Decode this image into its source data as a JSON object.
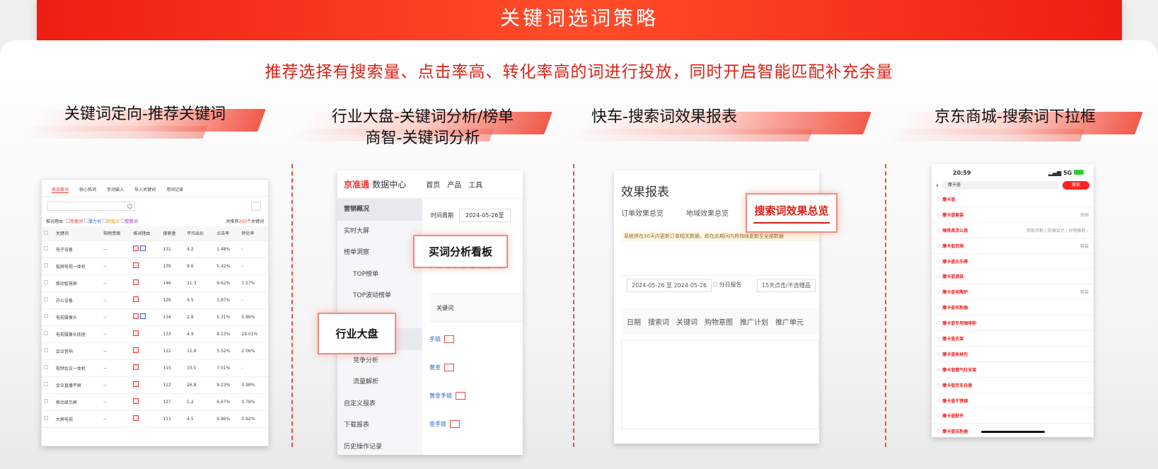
{
  "banner_title": "关键词选词策略",
  "subtitle": "推荐选择有搜索量、点击率高、转化率高的词进行投放，同时开启智能匹配补充余量",
  "sections": [
    {
      "label": "关键词定向-推荐关键词"
    },
    {
      "label": "行业大盘-关键词分析/榜单",
      "label2": "商智-关键词分析"
    },
    {
      "label": "快车-搜索词效果报表"
    },
    {
      "label": "京东商城-搜索词下拉框"
    }
  ],
  "s1": {
    "tabs": [
      "商品推词",
      "核心拓词",
      "手动输入",
      "导入关键词",
      "用词记录"
    ],
    "reason_label": "推词理由:",
    "reasons": [
      "热搜词",
      "潜力词",
      "拍搜词",
      "整套词"
    ],
    "total_prefix": "共推荐",
    "total_count": "203",
    "total_suffix": "个关键词",
    "headers": [
      "关键词",
      "购物意图",
      "推词理由",
      "搜索量",
      "平均出价",
      "点击率",
      "转化率"
    ],
    "rows": [
      {
        "kw": "电子设备",
        "intent": "--",
        "two": true,
        "vol": "131",
        "bid": "4.2",
        "ctr": "1.48%",
        "cvr": "-"
      },
      {
        "kw": "投屏电视一体机",
        "intent": "--",
        "two": false,
        "vol": "139",
        "bid": "9.6",
        "ctr": "5.42%",
        "cvr": "-"
      },
      {
        "kw": "移动智慧屏",
        "intent": "--",
        "two": false,
        "vol": "146",
        "bid": "11.3",
        "ctr": "9.62%",
        "cvr": "1.57%"
      },
      {
        "kw": "办公设备",
        "intent": "--",
        "two": false,
        "vol": "126",
        "bid": "9.5",
        "ctr": "1.87%",
        "cvr": "-"
      },
      {
        "kw": "电视摄像头",
        "intent": "--",
        "two": true,
        "vol": "134",
        "bid": "2.8",
        "ctr": "5.31%",
        "cvr": "5.86%"
      },
      {
        "kw": "电视摄像头底座",
        "intent": "--",
        "two": false,
        "vol": "133",
        "bid": "4.9",
        "ctr": "8.13%",
        "cvr": "29.01%"
      },
      {
        "kw": "会议音响",
        "intent": "--",
        "two": false,
        "vol": "122",
        "bid": "12.8",
        "ctr": "5.52%",
        "cvr": "2.06%"
      },
      {
        "kw": "视频会议一体机",
        "intent": "--",
        "two": false,
        "vol": "115",
        "bid": "33.5",
        "ctr": "7.01%",
        "cvr": "-"
      },
      {
        "kw": "会议直播平屏",
        "intent": "--",
        "two": false,
        "vol": "122",
        "bid": "26.8",
        "ctr": "9.23%",
        "cvr": "0.98%"
      },
      {
        "kw": "移动显示屏",
        "intent": "--",
        "two": false,
        "vol": "127",
        "bid": "5.2",
        "ctr": "6.67%",
        "cvr": "0.78%"
      },
      {
        "kw": "大屏电视",
        "intent": "--",
        "two": false,
        "vol": "113",
        "bid": "4.5",
        "ctr": "9.86%",
        "cvr": "0.92%"
      }
    ]
  },
  "s2": {
    "logo": "京准通",
    "logo_sub": "数据中心",
    "nav": [
      "首页",
      "产品",
      "工具"
    ],
    "side": [
      "营销概况",
      "实时大屏",
      "榜单洞察",
      "TOP榜单",
      "TOP波动榜单",
      "",
      "竞争分析",
      "流量解析",
      "自定义报表",
      "下载报表",
      "历史操作记录"
    ],
    "date_label": "时间周期",
    "date_value": "2024-05-26至",
    "notice": "声明：已购关键词是根据您所属类",
    "col_header": "关键词",
    "keywords": [
      "手链",
      "黄金",
      "黄金手链",
      "金手链"
    ],
    "highlight1": "买词分析看板",
    "highlight2": "行业大盘"
  },
  "s3": {
    "title": "效果报表",
    "tabs": [
      "订单效果总览",
      "地域效果总览"
    ],
    "highlight": "搜索词效果总览",
    "notice": "系统将在30天内更新订单相关数据，即在此期间内将持续更新至全部数据",
    "date_range": "2024-05-26 至 2024-05-26",
    "daily": "分日报告",
    "select": "15天点击/不含赠品",
    "cols": [
      "日期",
      "搜索词",
      "关键词",
      "购物意图",
      "推广计划",
      "推广单元"
    ]
  },
  "s4": {
    "time": "20:59",
    "signal": "5G",
    "query": "摩卡壶",
    "search_btn": "搜索",
    "items": [
      {
        "t": "摩卡壶",
        "r": ""
      },
      {
        "t": "摩卡壶套装",
        "r": "双阀"
      },
      {
        "t": "咖啡具怎么挑",
        "r": "萃取浓郁 | 防爆设计 | 好物推荐 ›"
      },
      {
        "t": "摩卡壶双阀",
        "r": "套装"
      },
      {
        "t": "摩卡壶比乐蒂",
        "r": ""
      },
      {
        "t": "摩卡壶滤纸",
        "r": ""
      },
      {
        "t": "摩卡壶电陶炉",
        "r": "套装"
      },
      {
        "t": "摩卡壶布粉器",
        "r": ""
      },
      {
        "t": "摩卡壶专用咖啡粉",
        "r": ""
      },
      {
        "t": "摩卡壶支架",
        "r": ""
      },
      {
        "t": "摩卡壶收纳包",
        "r": ""
      },
      {
        "t": "摩卡壶燃气灶支架",
        "r": ""
      },
      {
        "t": "摩卡壶京东自营",
        "r": ""
      },
      {
        "t": "摩卡壶不锈钢",
        "r": ""
      },
      {
        "t": "摩卡壶配件",
        "r": ""
      },
      {
        "t": "摩卡壶压粉器",
        "r": ""
      }
    ]
  }
}
